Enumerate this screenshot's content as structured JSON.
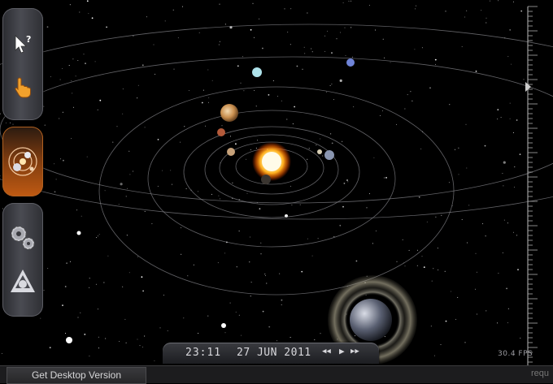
{
  "toolbar": {
    "help_cursor_icon": "arrow-question-icon",
    "hand_icon": "pointing-hand-icon",
    "solar_system_icon": "orbit-view-icon",
    "settings_icon": "gears-icon",
    "logo_icon": "triangle-logo-icon"
  },
  "timebar": {
    "time": "23:11",
    "date": "27 JUN 2011",
    "rewind": "◀◀",
    "play": "▶",
    "forward": "▶▶"
  },
  "fps": "30.4 FPS",
  "bottom_bar": {
    "desktop_button": "Get Desktop Version",
    "right_text": "requ"
  },
  "colors": {
    "sun": "#ffdd66",
    "active_tool": "#c05a12",
    "orbit": "#8a8a90"
  }
}
